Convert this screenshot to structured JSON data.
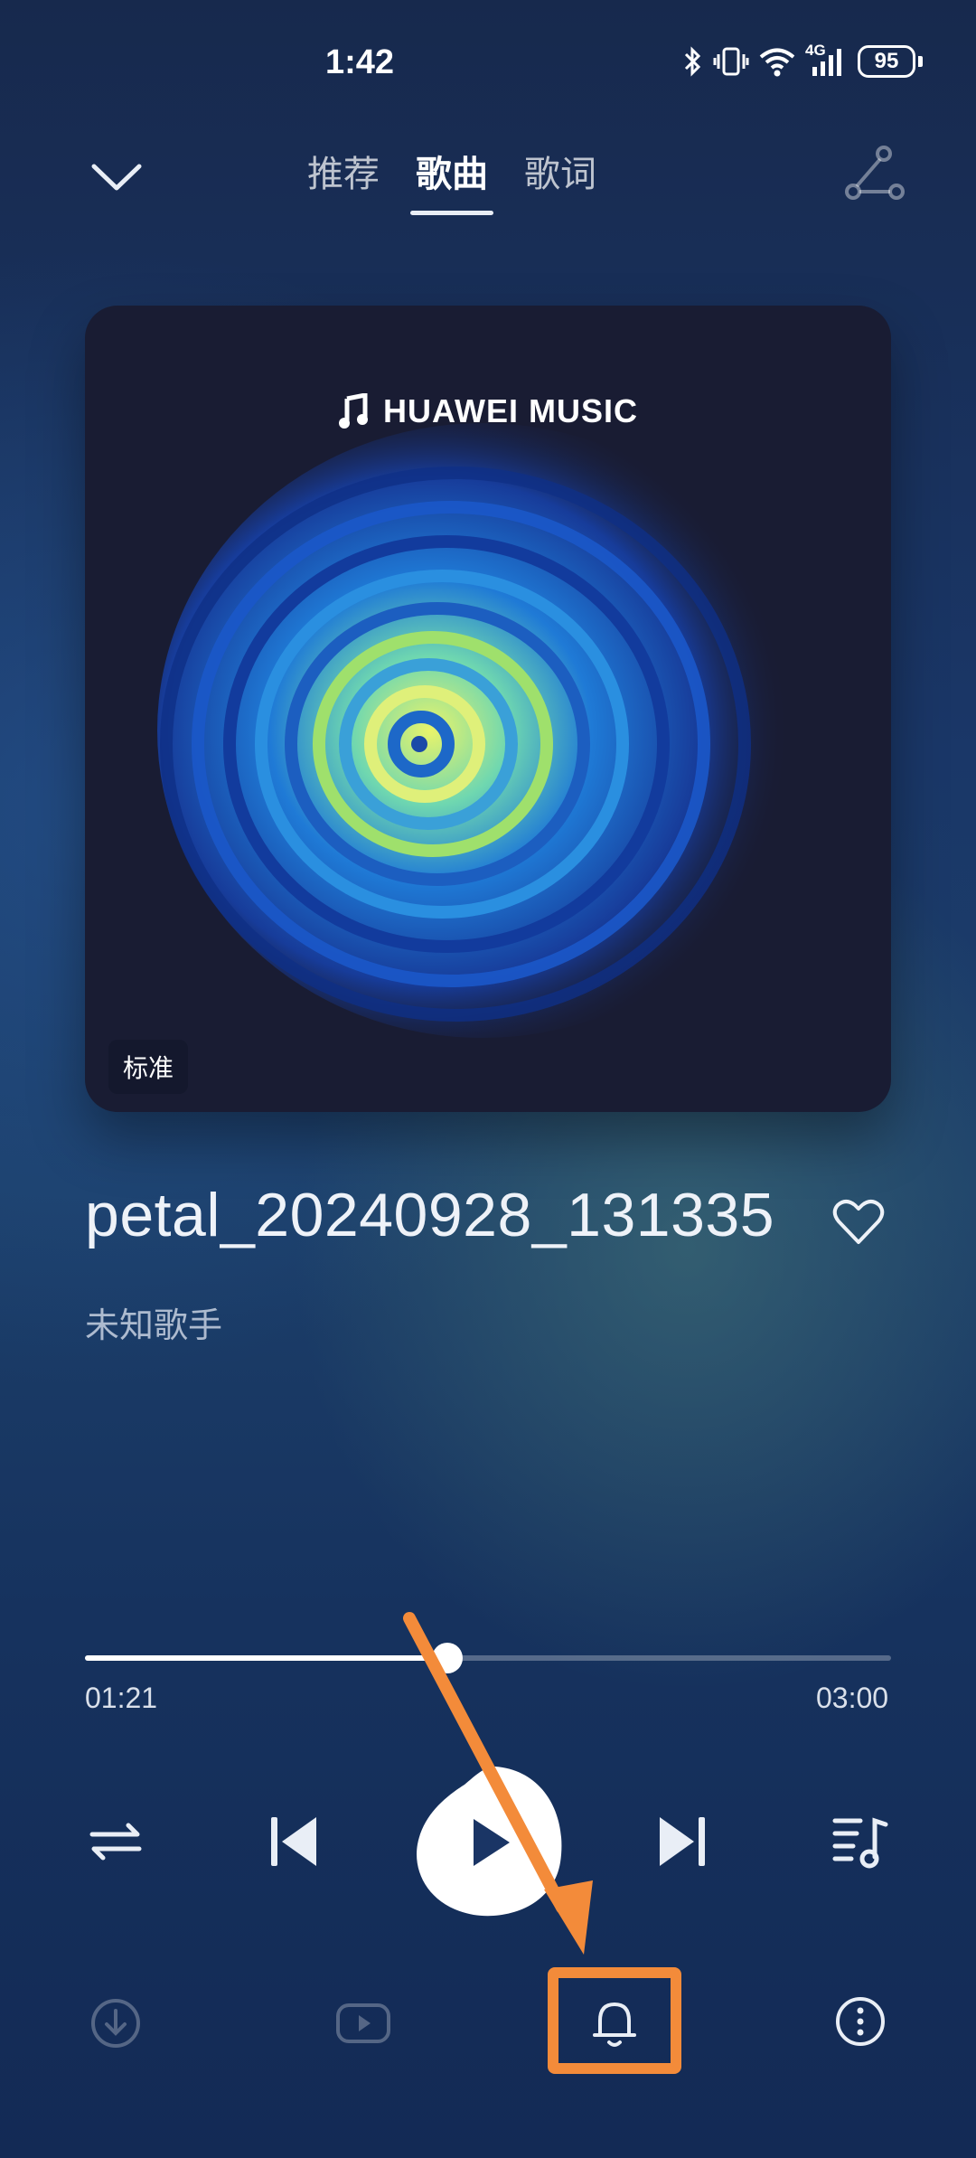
{
  "status_bar": {
    "time": "1:42",
    "network": "4G",
    "battery": "95",
    "icons": [
      "bluetooth-icon",
      "vibrate-icon",
      "wifi-icon",
      "cellular-signal-icon",
      "battery-icon"
    ]
  },
  "header": {
    "tabs": [
      {
        "label": "推荐",
        "active": false
      },
      {
        "label": "歌曲",
        "active": true
      },
      {
        "label": "歌词",
        "active": false
      }
    ],
    "collapse_icon": "chevron-down-icon",
    "share_icon": "share-icon"
  },
  "cover": {
    "brand": "HUAWEI MUSIC",
    "quality_badge": "标准"
  },
  "song": {
    "title": "petal_20240928_131335",
    "artist": "未知歌手",
    "favorite_icon": "heart-icon"
  },
  "progress": {
    "current": "01:21",
    "total": "03:00",
    "fraction": 0.45
  },
  "controls": {
    "icons": [
      "repeat-icon",
      "previous-icon",
      "play-icon",
      "next-icon",
      "playlist-icon"
    ]
  },
  "bottom_bar": {
    "icons": [
      "download-icon",
      "video-icon",
      "bell-icon",
      "more-icon"
    ],
    "highlighted": "bell-icon"
  },
  "colors": {
    "accent_annotation": "#f38b3a",
    "background_top": "#17294d",
    "cover_bg": "#191c33"
  }
}
